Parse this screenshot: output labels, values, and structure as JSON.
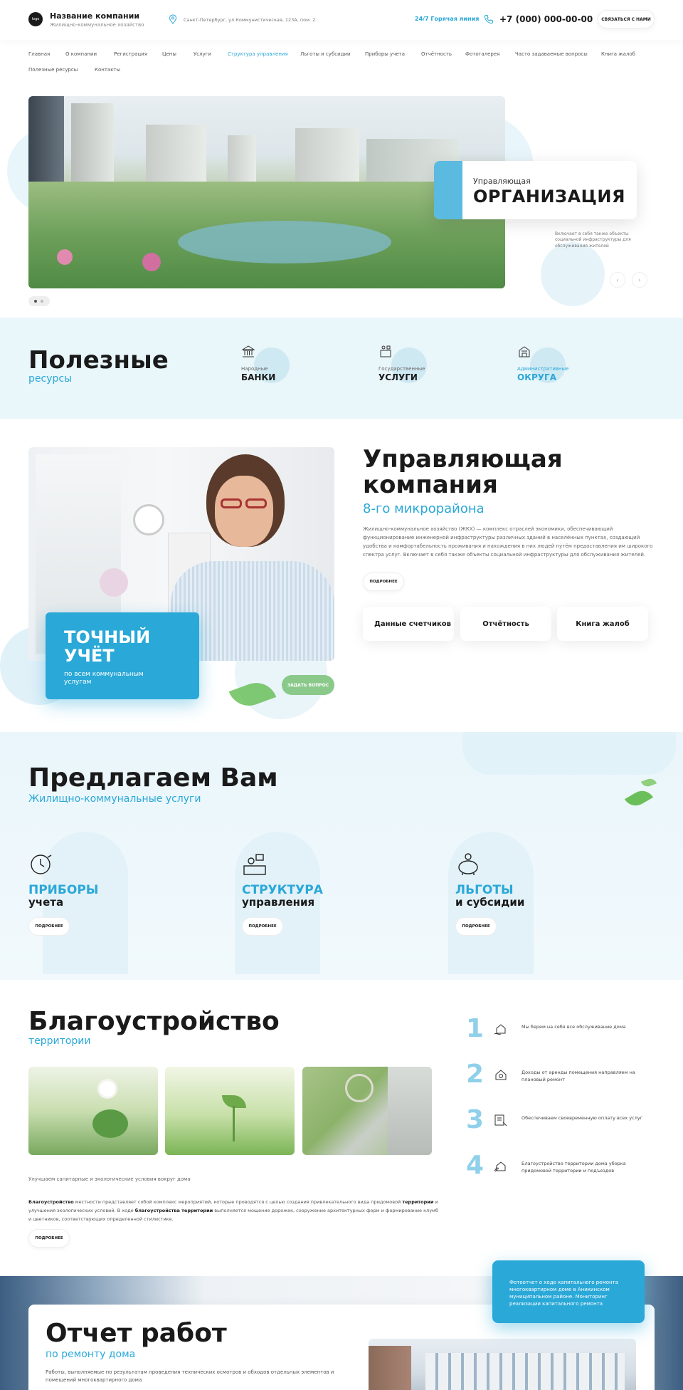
{
  "header": {
    "logo_text": "logo",
    "company_name": "Название компании",
    "company_sub": "Жилищно-коммунальное хозяйство",
    "address": "Санкт-Петербург, ул.Коммунистическая, 123А, пом. 2",
    "hotline": "24/7  Горячая линия",
    "phone": "+7 (000) 000-00-00",
    "contact_btn": "СВЯЗАТЬСЯ С НАМИ"
  },
  "nav": {
    "items": [
      "Главная",
      "О компании",
      "Регистрация",
      "Цены",
      "Услуги",
      "Структура управления",
      "Льготы и субсидии",
      "Приборы учета",
      "Отчётность",
      "Фотогалерея",
      "Часто задаваемые вопросы",
      "Книга жалоб",
      "Полезные ресурсы",
      "Контакты"
    ],
    "active_index": 5
  },
  "hero": {
    "card_pre": "Управляющая",
    "card_title": "ОРГАНИЗАЦИЯ",
    "desc": "Включает в себя также объекты социальной инфраструктуры для обслуживания жителей",
    "prev": "‹",
    "next": "›"
  },
  "resources": {
    "title": "Полезные",
    "subtitle": "ресурсы",
    "items": [
      {
        "small": "Народные",
        "big": "БАНКИ",
        "icon": "bank-icon"
      },
      {
        "small": "Государственные",
        "big": "УСЛУГИ",
        "icon": "services-icon"
      },
      {
        "small": "Административные",
        "big": "ОКРУГА",
        "icon": "district-icon",
        "highlight": true
      }
    ]
  },
  "company": {
    "blue_title": "ТОЧНЫЙ УЧЁТ",
    "blue_sub": "по всем коммунальным услугам",
    "ask_btn": "ЗАДАТЬ ВОПРОС",
    "title": "Управляющая компания",
    "subtitle": "8-го микрорайона",
    "text": "Жилищно-коммунальное хозяйство (ЖКХ) — комплекс отраслей экономики, обеспечивающий функционирование инженерной инфраструктуры различных зданий в населённых пунктах, создающий удобства и комфортабельность проживания и нахождения в них людей путём предоставления им широкого спектра услуг. Включает в себя также объекты социальной инфраструктуры для обслуживания жителей.",
    "more_btn": "ПОДРОБНЕЕ",
    "cards": [
      "Данные счетчиков",
      "Отчётность",
      "Книга жалоб"
    ]
  },
  "services": {
    "title": "Предлагаем Вам",
    "subtitle": "Жилищно-коммунальные услуги",
    "items": [
      {
        "a": "ПРИБОРЫ",
        "b": "учета",
        "btn": "ПОДРОБНЕЕ",
        "icon": "meter-icon"
      },
      {
        "a": "СТРУКТУРА",
        "b": "управления",
        "btn": "ПОДРОБНЕЕ",
        "icon": "structure-icon"
      },
      {
        "a": "ЛЬГОТЫ",
        "b": "и субсидии",
        "btn": "ПОДРОБНЕЕ",
        "icon": "piggy-bank-icon"
      }
    ]
  },
  "landscaping": {
    "title": "Благоустройство",
    "subtitle": "территории",
    "caption": "Улучшаем санитарные и экологические условия вокруг дома",
    "text_b1": "Благоустройство",
    "text_1": " местности представляет собой комплекс мероприятий, которые проводятся с целью создания привлекательного вида придомовой ",
    "text_b2": "территории",
    "text_2": " и улучшения экологических условий. В ходе ",
    "text_b3": "благоустройства территории",
    "text_3": " выполняется мощение дорожек, сооружение архитектурных форм и формирование клумб и цветников, соответствующих определенной стилистике.",
    "more_btn": "ПОДРОБНЕЕ",
    "steps": [
      {
        "num": "1",
        "text": "Мы берем на себя все обслуживание дома",
        "icon": "house-hands-icon"
      },
      {
        "num": "2",
        "text": "Доходы от аренды помещения направляем на плановый ремонт",
        "icon": "money-house-icon"
      },
      {
        "num": "3",
        "text": "Обеспечиваем своевременную оплату всех услуг",
        "icon": "payment-icon"
      },
      {
        "num": "4",
        "text": "Благоустройство территории дома уборка придомовой территории и подъездов",
        "icon": "cleaning-icon"
      }
    ]
  },
  "report": {
    "title": "Отчет работ",
    "subtitle": "по ремонту дома",
    "text": "Работы, выполняемые по результатам проведения технических осмотров и обходов отдельных элементов и помещений многоквартирного дома",
    "blue_text": "Фотоотчет о ходе капитального ремонта многоквартирном доме в Аникинском муниципальном районе. Мониторинг реализации капитального ремонта"
  },
  "colors": {
    "accent": "#2aa8d8",
    "light_bg": "#e9f6fa",
    "green": "#8bc98b"
  }
}
